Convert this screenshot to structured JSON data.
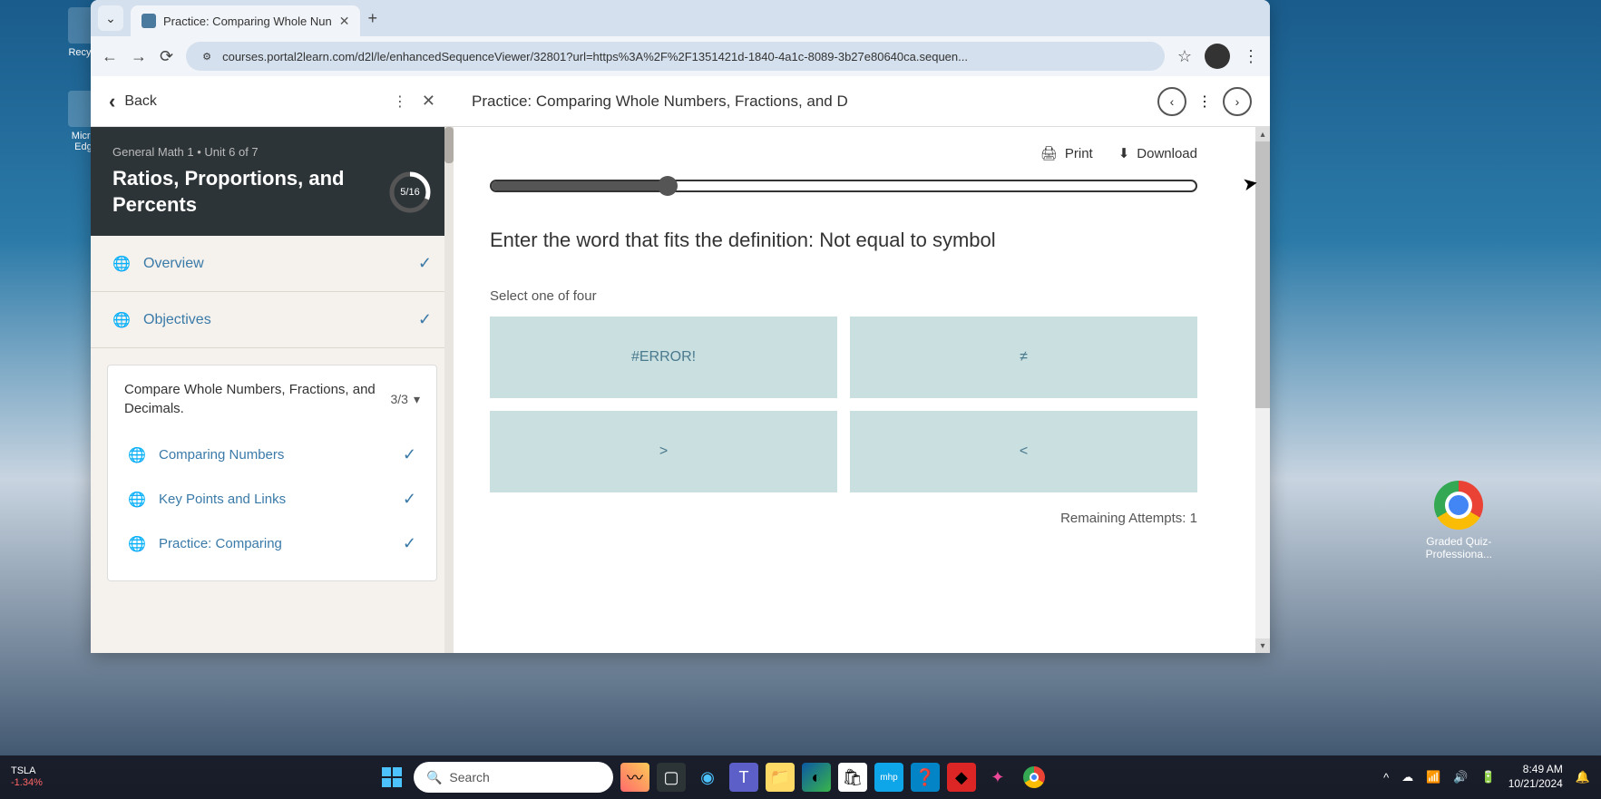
{
  "desktop": {
    "recycle": "Recycle",
    "edge": "Micros\nEdge"
  },
  "browser": {
    "tab_title": "Practice: Comparing Whole Nun",
    "url": "courses.portal2learn.com/d2l/le/enhancedSequenceViewer/32801?url=https%3A%2F%2F1351421d-1840-4a1c-8089-3b27e80640ca.sequen..."
  },
  "header": {
    "back": "Back",
    "title": "Practice: Comparing Whole Numbers, Fractions, and D"
  },
  "sidebar": {
    "breadcrumb_course": "General Math 1",
    "breadcrumb_unit": "Unit 6 of 7",
    "course_title": "Ratios, Proportions, and Percents",
    "progress": "5/16",
    "items": [
      {
        "label": "Overview"
      },
      {
        "label": "Objectives"
      }
    ],
    "section": {
      "title": "Compare Whole Numbers, Fractions, and Decimals.",
      "count": "3/3",
      "items": [
        {
          "label": "Comparing Numbers"
        },
        {
          "label": "Key Points and Links"
        },
        {
          "label": "Practice: Comparing"
        }
      ]
    }
  },
  "content": {
    "print": "Print",
    "download": "Download",
    "question": "Enter the word that fits the definition: Not equal to symbol",
    "select_label": "Select one of four",
    "options": [
      "#ERROR!",
      "≠",
      ">",
      "<"
    ],
    "attempts": "Remaining Attempts: 1"
  },
  "right_icon": {
    "label": "Graded Quiz-\nProfessiona..."
  },
  "taskbar": {
    "stock_symbol": "TSLA",
    "stock_change": "-1.34%",
    "search_placeholder": "Search",
    "time": "8:49 AM",
    "date": "10/21/2024"
  }
}
